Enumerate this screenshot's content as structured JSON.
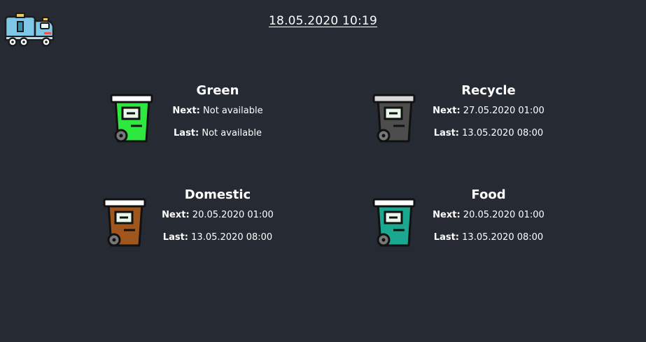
{
  "header": {
    "datetime": "18.05.2020 10:19",
    "logo_icon": "garbage-truck-icon"
  },
  "labels": {
    "next": "Next:",
    "last": "Last:"
  },
  "bins": [
    {
      "name": "Green",
      "color": "#2ee83f",
      "next": "Not available",
      "last": "Not available"
    },
    {
      "name": "Recycle",
      "color": "#4d4d4d",
      "next": "27.05.2020 01:00",
      "last": "13.05.2020 08:00"
    },
    {
      "name": "Domestic",
      "color": "#a0561c",
      "next": "20.05.2020 01:00",
      "last": "13.05.2020 08:00"
    },
    {
      "name": "Food",
      "color": "#1ba890",
      "next": "20.05.2020 01:00",
      "last": "13.05.2020 08:00"
    }
  ]
}
